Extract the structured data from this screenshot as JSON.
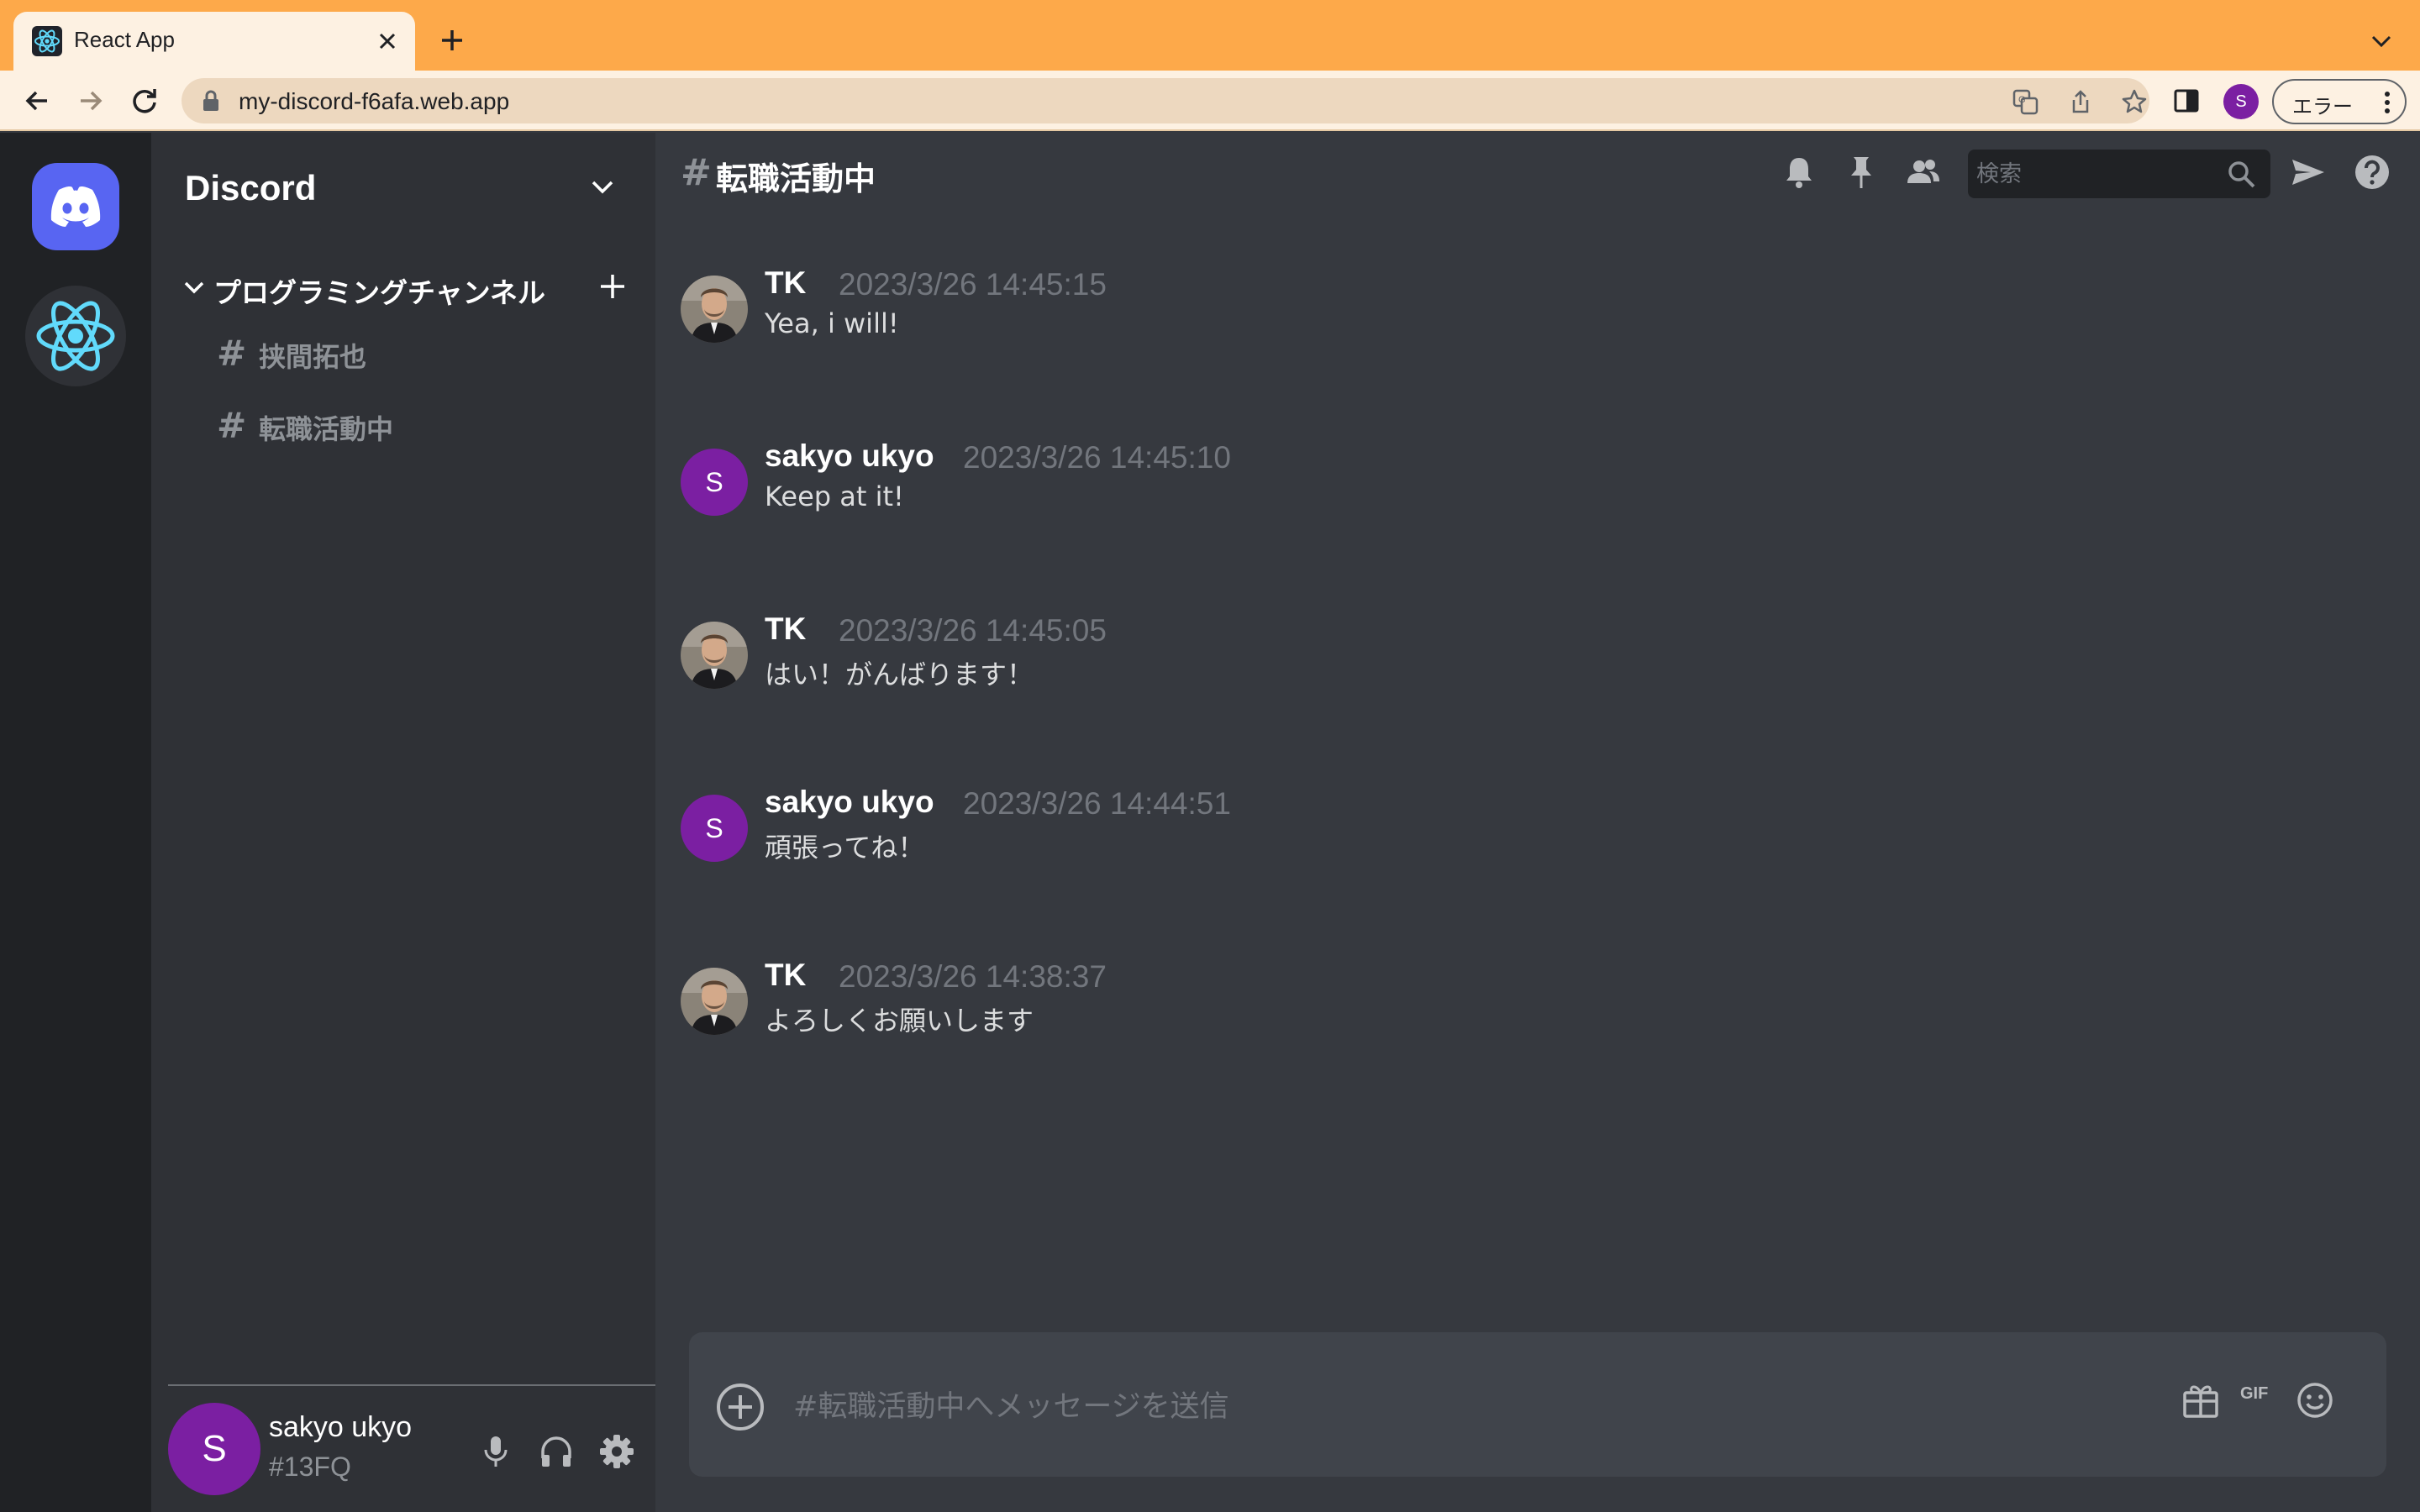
{
  "browser": {
    "tab_title": "React App",
    "url": "my-discord-f6afa.web.app",
    "profile_initial": "S",
    "error_label": "エラー"
  },
  "server": {
    "name": "Discord"
  },
  "sidebar": {
    "category": "プログラミングチャンネル",
    "channels": [
      {
        "hash": "#",
        "label": "挟間拓也"
      },
      {
        "hash": "#",
        "label": "転職活動中"
      }
    ]
  },
  "user_panel": {
    "avatar_initial": "S",
    "name": "sakyo ukyo",
    "tag": "#13FQ"
  },
  "chat_header": {
    "hash": "#",
    "channel": "転職活動中",
    "search_placeholder": "検索"
  },
  "messages": [
    {
      "author": "TK",
      "timestamp": "2023/3/26 14:45:15",
      "text": "Yea, i will!",
      "avatar": "photo"
    },
    {
      "author": "sakyo ukyo",
      "timestamp": "2023/3/26 14:45:10",
      "text": "Keep at it!",
      "avatar": "S"
    },
    {
      "author": "TK",
      "timestamp": "2023/3/26 14:45:05",
      "text": "はい！がんばります！",
      "avatar": "photo"
    },
    {
      "author": "sakyo ukyo",
      "timestamp": "2023/3/26 14:44:51",
      "text": "頑張ってね！",
      "avatar": "S"
    },
    {
      "author": "TK",
      "timestamp": "2023/3/26 14:38:37",
      "text": "よろしくお願いします",
      "avatar": "photo"
    }
  ],
  "composer": {
    "placeholder": "#転職活動中へメッセージを送信",
    "gif_label": "GIF"
  },
  "colors": {
    "brand": "#5865f2",
    "user_avatar": "#7b1fa2",
    "browser_accent": "#fda94a"
  }
}
